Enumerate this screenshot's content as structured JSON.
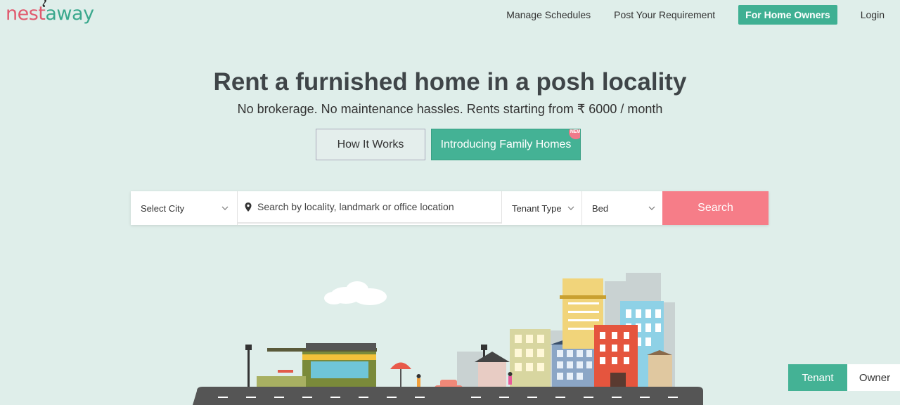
{
  "brand": {
    "part1": "nest",
    "part2": "away"
  },
  "nav": {
    "manage_schedules": "Manage Schedules",
    "post_requirement": "Post Your Requirement",
    "home_owners": "For Home Owners",
    "login": "Login"
  },
  "hero": {
    "title": "Rent a furnished home in a posh locality",
    "subtitle": "No brokerage. No maintenance hassles. Rents starting from ₹ 6000 / month",
    "how_it_works": "How It Works",
    "family_homes": "Introducing Family Homes",
    "new_badge": "NEW"
  },
  "search": {
    "city_label": "Select City",
    "location_placeholder": "Search by locality, landmark or office location",
    "tenant_type_label": "Tenant Type",
    "bed_label": "Bed",
    "search_button": "Search"
  },
  "toggle": {
    "tenant": "Tenant",
    "owner": "Owner"
  },
  "colors": {
    "accent": "#44b295",
    "search": "#f67d88",
    "background": "#dfeeea"
  },
  "icons": {
    "location": "map-pin-icon",
    "dropdown": "chevron-down-icon"
  }
}
